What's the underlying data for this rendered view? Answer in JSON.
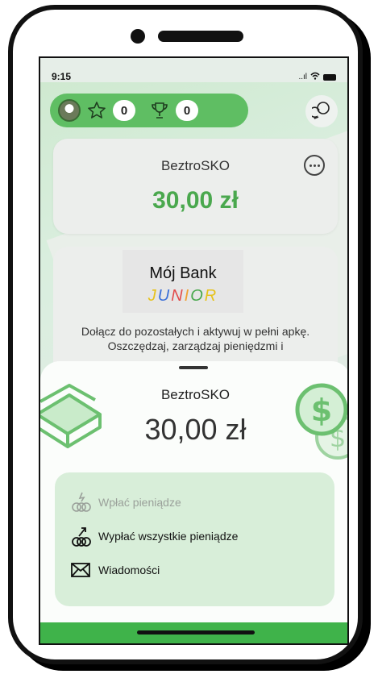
{
  "status_bar": {
    "time": "9:15",
    "signal": "..ıl"
  },
  "topbar": {
    "stars_count": "0",
    "trophies_count": "0"
  },
  "account_card": {
    "name": "BeztroSKO",
    "balance": "30,00 zł"
  },
  "promo_card": {
    "logo_title": "Mój Bank",
    "logo_subtitle_letters": [
      "J",
      "U",
      "N",
      "I",
      "O",
      "R"
    ],
    "logo_subtitle_colors": [
      "#e6c21b",
      "#3a6fd8",
      "#e24b4b",
      "#f0a030",
      "#4aa84e",
      "#e6c21b"
    ],
    "text": "Dołącz do pozostałych i aktywuj w pełni apkę. Oszczędzaj, zarządzaj pieniędzmi i"
  },
  "sheet": {
    "account_name": "BeztroSKO",
    "balance": "30,00 zł",
    "actions": [
      {
        "label": "Wpłać pieniądze",
        "enabled": false,
        "icon": "deposit-coins-icon"
      },
      {
        "label": "Wypłać wszystkie pieniądze",
        "enabled": true,
        "icon": "withdraw-coins-icon"
      },
      {
        "label": "Wiadomości",
        "enabled": true,
        "icon": "envelope-icon"
      }
    ]
  },
  "colors": {
    "brand_green": "#5fbe63",
    "amount_green": "#4aa84e",
    "actions_bg": "#d8eed9",
    "footer_green": "#3fb34a"
  }
}
